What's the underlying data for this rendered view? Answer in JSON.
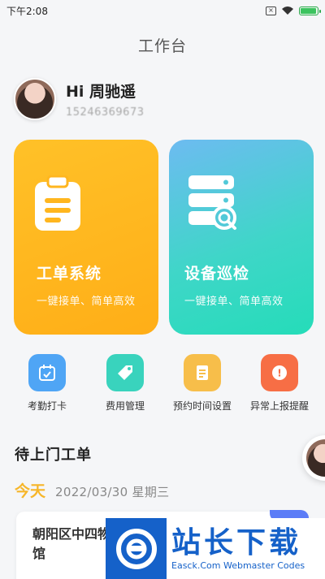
{
  "status_bar": {
    "time": "下午2:08",
    "battery_level": 0.85,
    "colors": {
      "battery": "#3cc35f"
    }
  },
  "header": {
    "title": "工作台"
  },
  "user": {
    "greeting": "Hi 周驰遥",
    "phone": "15246369673"
  },
  "cards": [
    {
      "title": "工单系统",
      "subtitle": "一键接单、简单高效",
      "icon": "clipboard-icon",
      "color": "#ffb61f"
    },
    {
      "title": "设备巡检",
      "subtitle": "一键接单、简单高效",
      "icon": "server-search-icon",
      "color": "#31d9c1"
    }
  ],
  "quick_actions": [
    {
      "label": "考勤打卡",
      "icon": "calendar-check-icon",
      "color": "#4fa5f5"
    },
    {
      "label": "费用管理",
      "icon": "tag-icon",
      "color": "#39d3bd"
    },
    {
      "label": "预约时间设置",
      "icon": "document-icon",
      "color": "#f7be4a"
    },
    {
      "label": "异常上报提醒",
      "icon": "alert-badge-icon",
      "color": "#f76e45"
    }
  ],
  "pending": {
    "title": "待上门工单",
    "today_label": "今天",
    "date": "2022/03/30 星期三",
    "order": {
      "title": "朝阳区中四物馆"
    }
  },
  "watermark": {
    "cn": "站长下载",
    "en": "Easck.Com Webmaster Codes"
  }
}
